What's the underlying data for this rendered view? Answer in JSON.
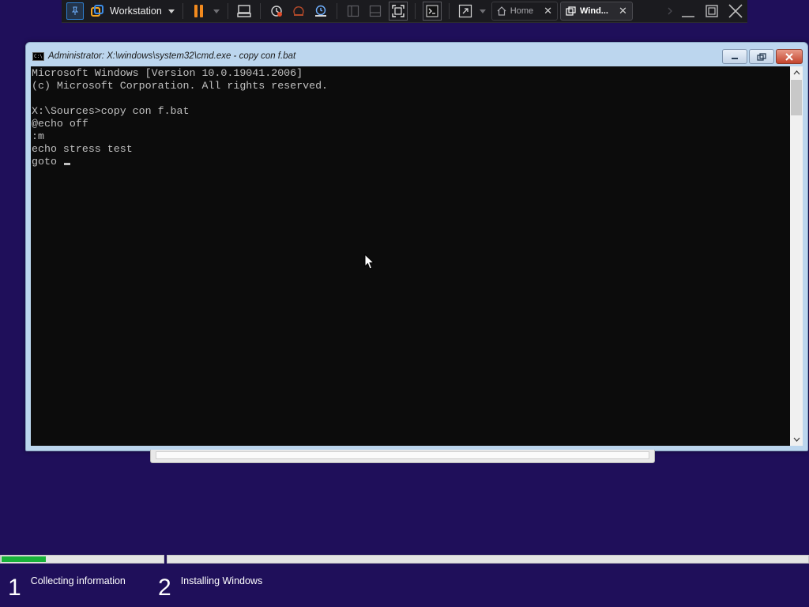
{
  "toolbar": {
    "product": "Workstation",
    "icons": [
      "pin-icon",
      "workstation-logo-icon",
      "pause-icon",
      "send-keys-icon",
      "snapshot-icon",
      "revert-snapshot-icon",
      "snapshot-manager-icon",
      "library-icon",
      "thumbnail-bar-icon",
      "fullscreen-icon",
      "console-view-icon",
      "unity-icon"
    ],
    "tabs": [
      {
        "label": "Home",
        "active": false
      },
      {
        "label": "Wind...",
        "active": true
      }
    ],
    "close_glyph": "✕"
  },
  "cmd": {
    "title": "Administrator: X:\\windows\\system32\\cmd.exe - copy  con f.bat",
    "icon_text": "C:\\",
    "lines": [
      "Microsoft Windows [Version 10.0.19041.2006]",
      "(c) Microsoft Corporation. All rights reserved.",
      "",
      "X:\\Sources>copy con f.bat",
      "@echo off",
      ":m",
      "echo stress test",
      "goto "
    ]
  },
  "setup": {
    "progress_fraction_step1": 0.27,
    "steps": [
      {
        "number": "1",
        "label": "Collecting information"
      },
      {
        "number": "2",
        "label": "Installing Windows"
      }
    ]
  },
  "colors": {
    "desktop": "#1f0f5a",
    "progress": "#19b13a",
    "pause": "#f28a1e",
    "console_bg": "#0c0c0c",
    "console_fg": "#c0c0c0"
  }
}
